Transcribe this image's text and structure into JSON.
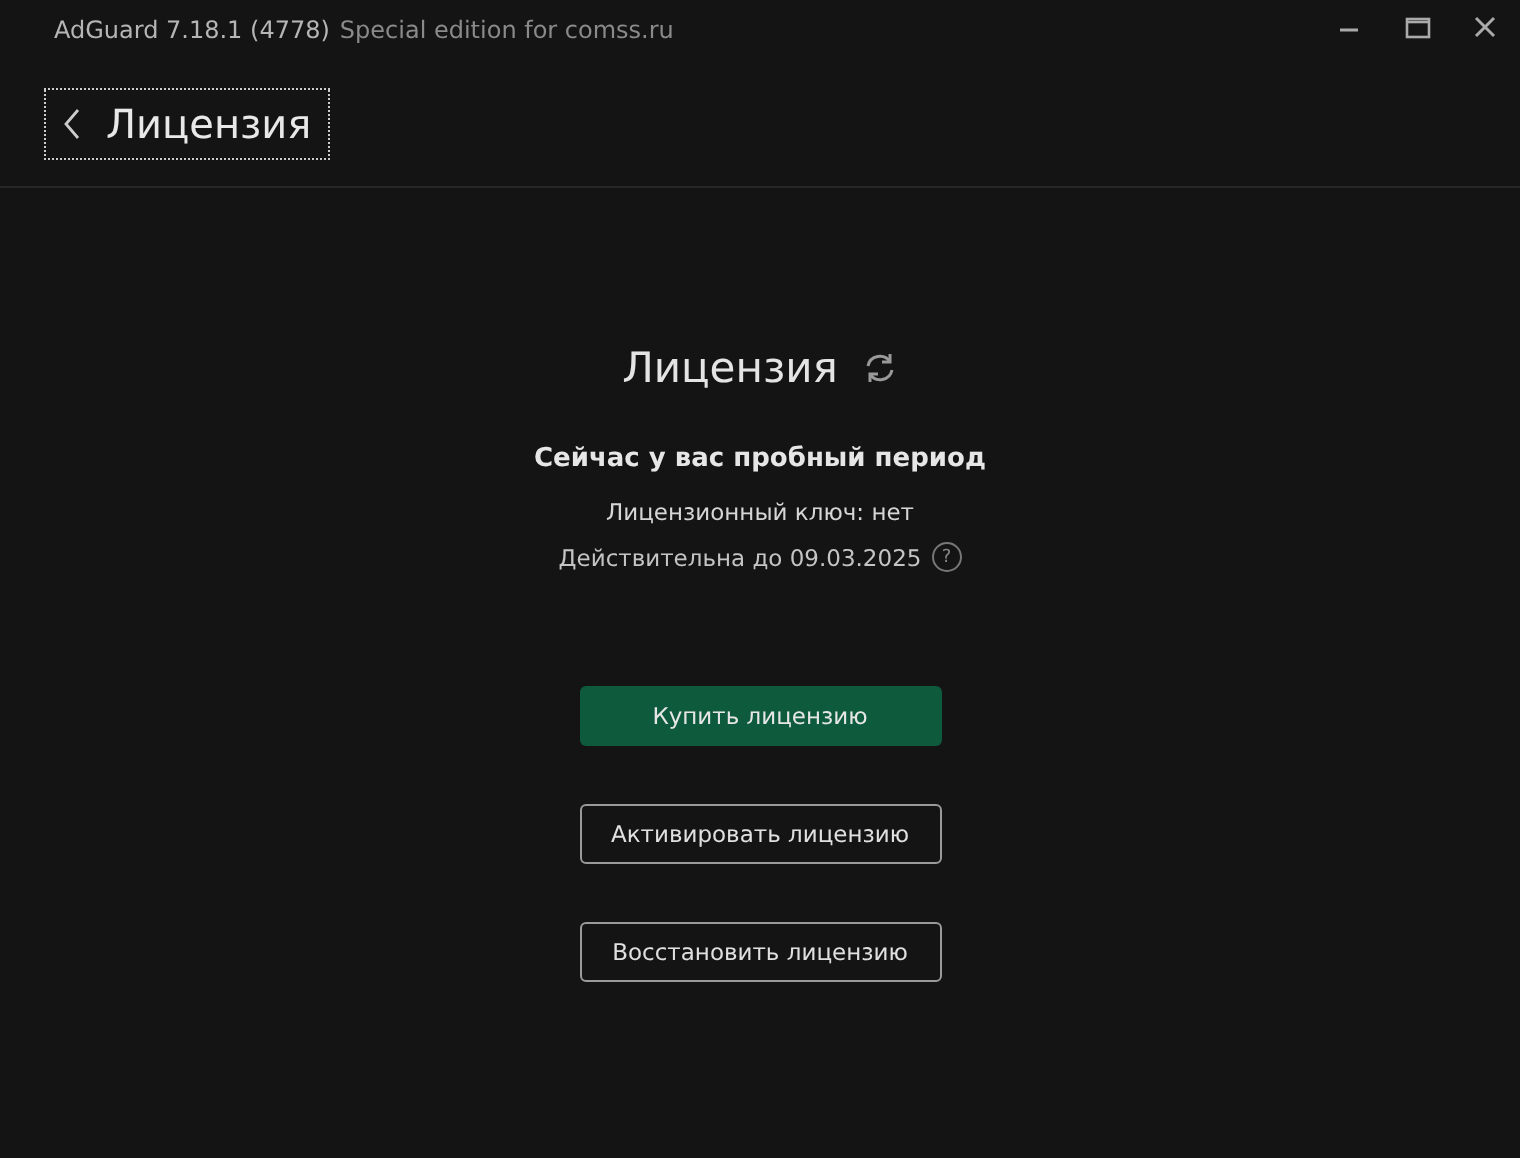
{
  "window": {
    "title": "AdGuard 7.18.1 (4778)",
    "subtitle": "Special edition for comss.ru"
  },
  "header": {
    "back_label": "Лицензия"
  },
  "license": {
    "heading": "Лицензия",
    "status": "Сейчас у вас пробный период",
    "key": "Лицензионный ключ: нет",
    "valid_until": "Действительна до 09.03.2025",
    "help": "?"
  },
  "buttons": [
    {
      "label": "Купить лицензию",
      "kind": "primary"
    },
    {
      "label": "Активировать лицензию",
      "kind": "outline"
    },
    {
      "label": "Восстановить лицензию",
      "kind": "outline"
    }
  ]
}
